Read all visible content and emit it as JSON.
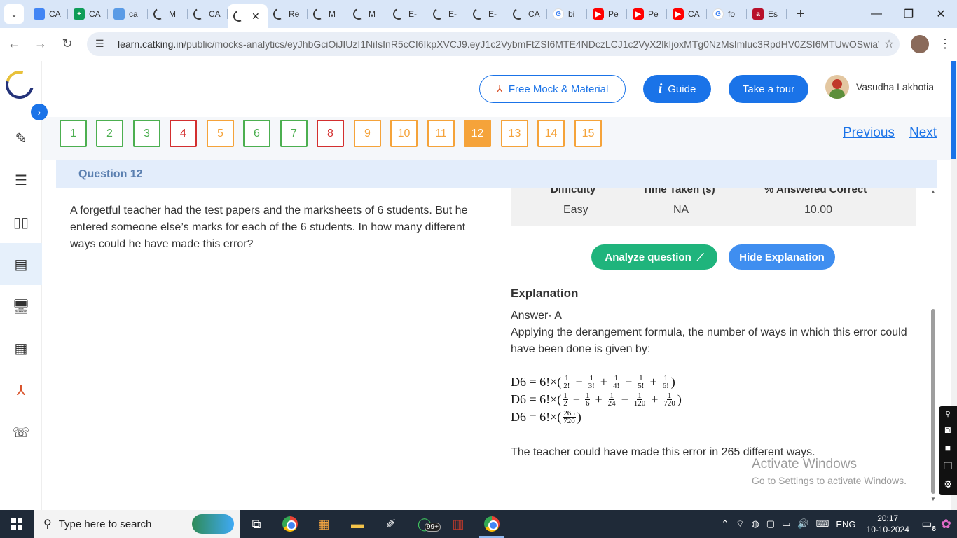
{
  "browser": {
    "tabs": [
      {
        "title": "CA",
        "icon": "docs"
      },
      {
        "title": "CA",
        "icon": "sheets"
      },
      {
        "title": "ca",
        "icon": "notes"
      },
      {
        "title": "M",
        "icon": "moon"
      },
      {
        "title": "CA",
        "icon": "moon"
      },
      {
        "title": "",
        "icon": "moon",
        "active": true
      },
      {
        "title": "Re",
        "icon": "moon"
      },
      {
        "title": "M",
        "icon": "moon"
      },
      {
        "title": "M",
        "icon": "moon"
      },
      {
        "title": "E-",
        "icon": "moon"
      },
      {
        "title": "E-",
        "icon": "moon"
      },
      {
        "title": "E-",
        "icon": "moon"
      },
      {
        "title": "CA",
        "icon": "moon"
      },
      {
        "title": "bi",
        "icon": "g"
      },
      {
        "title": "Pe",
        "icon": "yt"
      },
      {
        "title": "Pe",
        "icon": "yt"
      },
      {
        "title": "CA",
        "icon": "yt"
      },
      {
        "title": "fo",
        "icon": "g"
      },
      {
        "title": "Es",
        "icon": "a"
      }
    ],
    "new_tab": "+",
    "tab_close": "✕",
    "url": "learn.catking.in/public/mocks-analytics/eyJhbGciOiJIUzI1NiIsInR5cCI6IkpXVCJ9.eyJ1c2VybmFtZSI6MTE4NDczLCJ1c2VyX2lkIjoxMTg0NzMsImluc3RpdHV0ZSI6MTUwOSwiaWQi...",
    "url_domain": "learn.catking.in",
    "url_path": "/public/mocks-analytics/eyJhbGciOiJIUzI1NiIsInR5cCI6IkpXVCJ9.eyJ1c2VybmFtZSI6MTE4NDczLCJ1c2VyX2lkIjoxMTg0NzMsImluc3RpdHV0ZSI6MTUwOSwiaWQi..."
  },
  "header": {
    "free_mock": "Free Mock & Material",
    "guide": "Guide",
    "guide_icon": "i",
    "tour": "Take a tour",
    "user_name": "Vasudha Lakhotia"
  },
  "question_nav": {
    "items": [
      {
        "n": "1",
        "status": "green"
      },
      {
        "n": "2",
        "status": "green"
      },
      {
        "n": "3",
        "status": "green"
      },
      {
        "n": "4",
        "status": "red"
      },
      {
        "n": "5",
        "status": "orange"
      },
      {
        "n": "6",
        "status": "green"
      },
      {
        "n": "7",
        "status": "green"
      },
      {
        "n": "8",
        "status": "red"
      },
      {
        "n": "9",
        "status": "orange"
      },
      {
        "n": "10",
        "status": "orange"
      },
      {
        "n": "11",
        "status": "orange"
      },
      {
        "n": "12",
        "status": "current"
      },
      {
        "n": "13",
        "status": "orange"
      },
      {
        "n": "14",
        "status": "orange"
      },
      {
        "n": "15",
        "status": "orange"
      }
    ],
    "previous": "Previous",
    "next": "Next"
  },
  "question": {
    "title": "Question 12",
    "text": "A forgetful teacher had the test papers and the marksheets of 6 students. But he entered someone else’s marks for each of the 6 students. In how many different ways could he have made this error?"
  },
  "stats": {
    "headers": [
      "Difficulty",
      "Time Taken (s)",
      "% Answered Correct"
    ],
    "values": [
      "Easy",
      "NA",
      "10.00"
    ]
  },
  "actions": {
    "analyze": "Analyze question",
    "hide": "Hide Explanation"
  },
  "explanation": {
    "heading": "Explanation",
    "answer": "Answer- A",
    "intro": "Applying the derangement formula, the number of ways in which this error could have been done is given by:",
    "lhs": "D6 = 6!×",
    "row1": [
      [
        "1",
        "2!"
      ],
      [
        "1",
        "3!"
      ],
      [
        "1",
        "4!"
      ],
      [
        "1",
        "5!"
      ],
      [
        "1",
        "6!"
      ]
    ],
    "row2": [
      [
        "1",
        "2"
      ],
      [
        "1",
        "6"
      ],
      [
        "1",
        "24"
      ],
      [
        "1",
        "120"
      ],
      [
        "1",
        "720"
      ]
    ],
    "row3": [
      [
        "265",
        "720"
      ]
    ],
    "ops": [
      "−",
      "+",
      "−",
      "+"
    ],
    "conclusion": "The teacher could have made this error in 265 different ways."
  },
  "watermark": {
    "line1": "Activate Windows",
    "line2": "Go to Settings to activate Windows."
  },
  "taskbar": {
    "search_placeholder": "Type here to search",
    "badge": "99+",
    "lang": "ENG",
    "time": "20:17",
    "date": "10-10-2024",
    "notifications": "8"
  }
}
